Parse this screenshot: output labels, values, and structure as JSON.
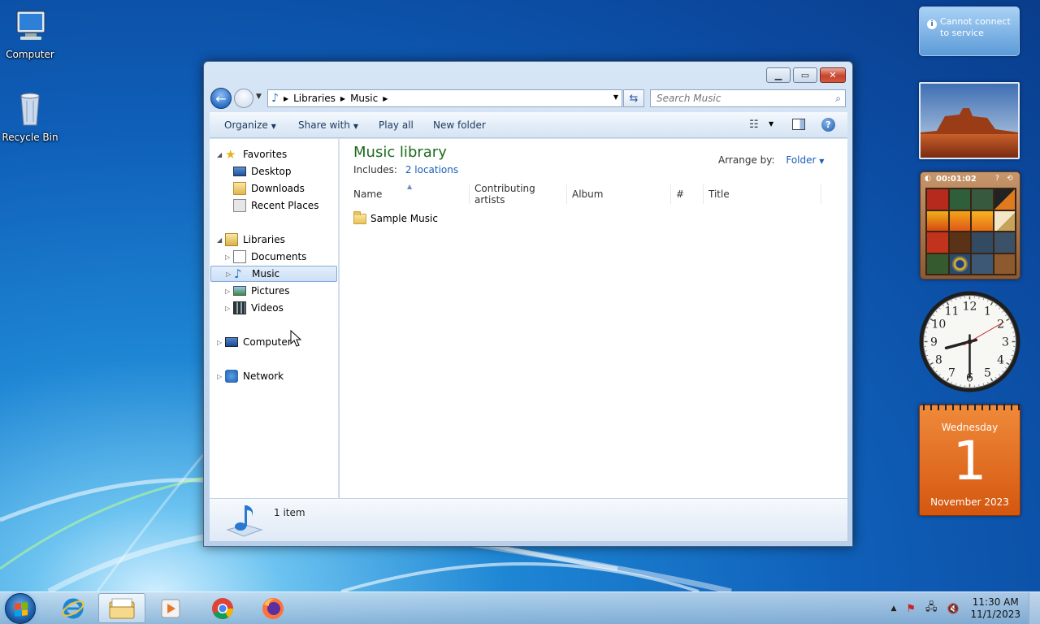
{
  "desktop": {
    "icons": [
      {
        "label": "Computer"
      },
      {
        "label": "Recycle Bin"
      }
    ]
  },
  "window": {
    "address": {
      "crumbs": [
        "Libraries",
        "Music"
      ]
    },
    "search": {
      "placeholder": "Search Music"
    },
    "toolbar": {
      "organize": "Organize",
      "share_with": "Share with",
      "play_all": "Play all",
      "new_folder": "New folder"
    },
    "nav": {
      "favorites": "Favorites",
      "desktop": "Desktop",
      "downloads": "Downloads",
      "recent": "Recent Places",
      "libraries": "Libraries",
      "documents": "Documents",
      "music": "Music",
      "pictures": "Pictures",
      "videos": "Videos",
      "computer": "Computer",
      "network": "Network"
    },
    "library": {
      "title": "Music library",
      "includes_label": "Includes:",
      "includes_link": "2 locations",
      "arrange_label": "Arrange by:",
      "arrange_value": "Folder"
    },
    "columns": [
      "Name",
      "Contributing artists",
      "Album",
      "#",
      "Title"
    ],
    "files": [
      {
        "name": "Sample Music",
        "type": "folder"
      }
    ],
    "status": {
      "count": "1 item"
    }
  },
  "gadgets": {
    "message": {
      "text": "Cannot connect to service"
    },
    "puzzle": {
      "timer": "00:01:02"
    },
    "clock": {
      "numbers": [
        "12",
        "1",
        "2",
        "3",
        "4",
        "5",
        "6",
        "7",
        "8",
        "9",
        "10",
        "11"
      ],
      "hour": 8,
      "minute": 30,
      "second": 10
    },
    "calendar": {
      "weekday": "Wednesday",
      "day": "1",
      "month_year": "November 2023"
    }
  },
  "taskbar": {
    "time": "11:30 AM",
    "date": "11/1/2023"
  },
  "colors": {
    "library_title": "#1d6b1d",
    "link": "#1a5fb4",
    "calendar": "#e06a1f"
  }
}
